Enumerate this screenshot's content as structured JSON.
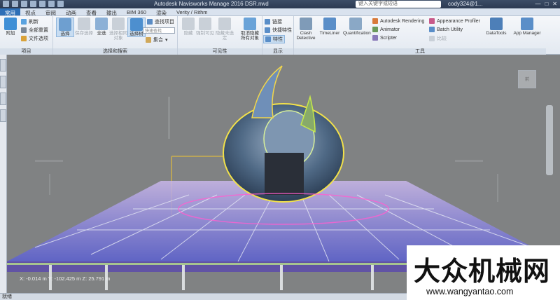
{
  "titlebar": {
    "title": "Autodesk Navisworks Manage 2016  DSR.nwd",
    "search_placeholder": "键入关键字或短语",
    "user": "cody324@1...",
    "win_min": "—",
    "win_max": "□",
    "win_close": "✕"
  },
  "tabs": [
    "常用",
    "视点",
    "审阅",
    "动画",
    "查看",
    "输出",
    "BIM 360",
    "渲染",
    "Verity / Rithm"
  ],
  "ribbon": {
    "project": {
      "label": "项目",
      "append": "附加",
      "refresh": "刷新",
      "reset_all": "全部重置",
      "file_options": "文件选项"
    },
    "select": {
      "label": "选择和搜索",
      "select_btn": "选择",
      "save_sel": "保存选择",
      "select_all": "全选",
      "select_same": "选择相同对象",
      "select_tree": "选择树",
      "find_items": "查找项目",
      "quick_find_placeholder": "快速查找",
      "set_label": "集合"
    },
    "visibility": {
      "label": "可见性",
      "hide": "隐藏",
      "hide_unselected": "隐藏未选定",
      "force_visible": "强制可见",
      "unhide_all": "取消隐藏所有对象"
    },
    "display": {
      "label": "显示",
      "links": "链接",
      "quick_props": "快捷特性",
      "properties": "特性"
    },
    "tools": {
      "label": "工具",
      "clash": "Clash Detective",
      "timeliner": "TimeLiner",
      "quantification": "Quantification",
      "autodesk_rendering": "Autodesk Rendering",
      "animator": "Animator",
      "scripter": "Scripter",
      "appearance_profiler": "Appearance Profiler",
      "batch_utility": "Batch Utility",
      "compare": "比较",
      "datatools": "DataTools",
      "app_manager": "App Manager"
    }
  },
  "viewport": {
    "coordinates": "X: -0.014 m  Y: -102.425 m  Z: 25.791 m",
    "viewcube_label": "前"
  },
  "statusbar": {
    "text": "就绪"
  },
  "watermark": {
    "cn": "大众机械网",
    "url": "www.wangyantao.com"
  },
  "colors": {
    "ribbon_bg": "#e8edf4",
    "file_tab": "#2e6fb7",
    "sky": "#808283"
  }
}
